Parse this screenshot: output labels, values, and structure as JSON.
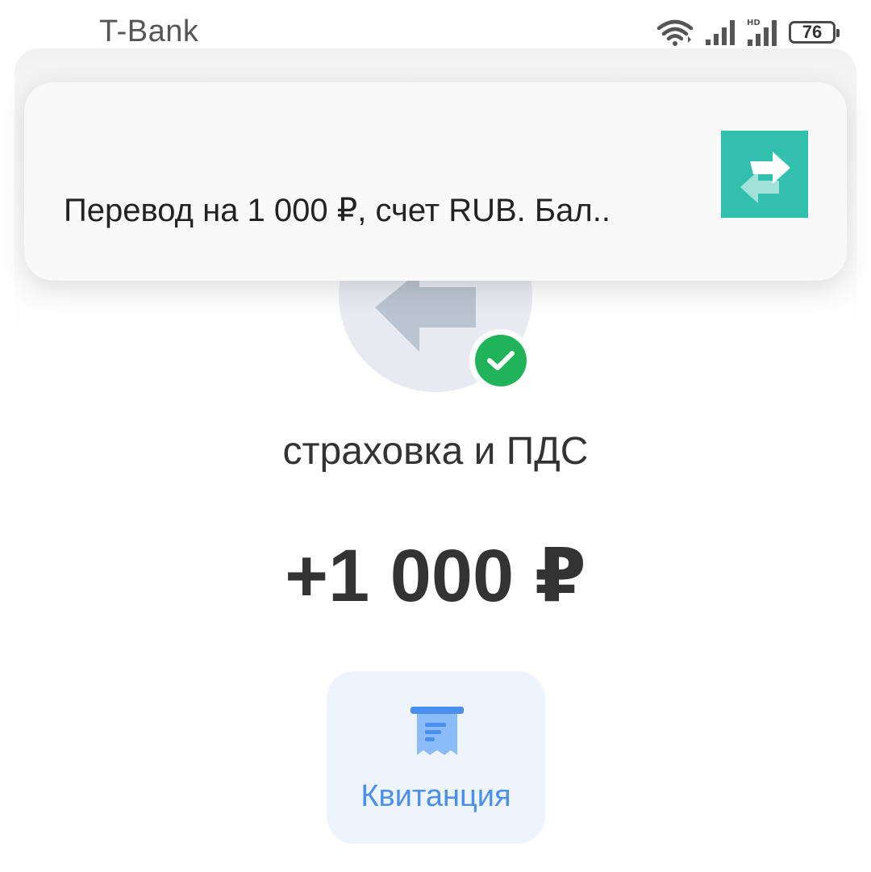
{
  "status_bar": {
    "carrier": "T-Bank",
    "battery_level": "76",
    "icons": [
      "wifi-icon",
      "signal-icon",
      "hd-signal-icon",
      "battery-icon"
    ]
  },
  "notification": {
    "text": "Перевод на 1 000 ₽, счет RUB. Бал..",
    "app_icon": "transfer-arrows-icon",
    "accent_color": "#32bfad"
  },
  "transaction": {
    "recipient": "страховка и ПДС",
    "amount": "+1 000 ₽",
    "status_icon": "check-icon",
    "status_color": "#21b35a"
  },
  "actions": {
    "receipt_label": "Квитанция",
    "receipt_icon": "receipt-icon",
    "accent_color": "#4a8ff0"
  }
}
